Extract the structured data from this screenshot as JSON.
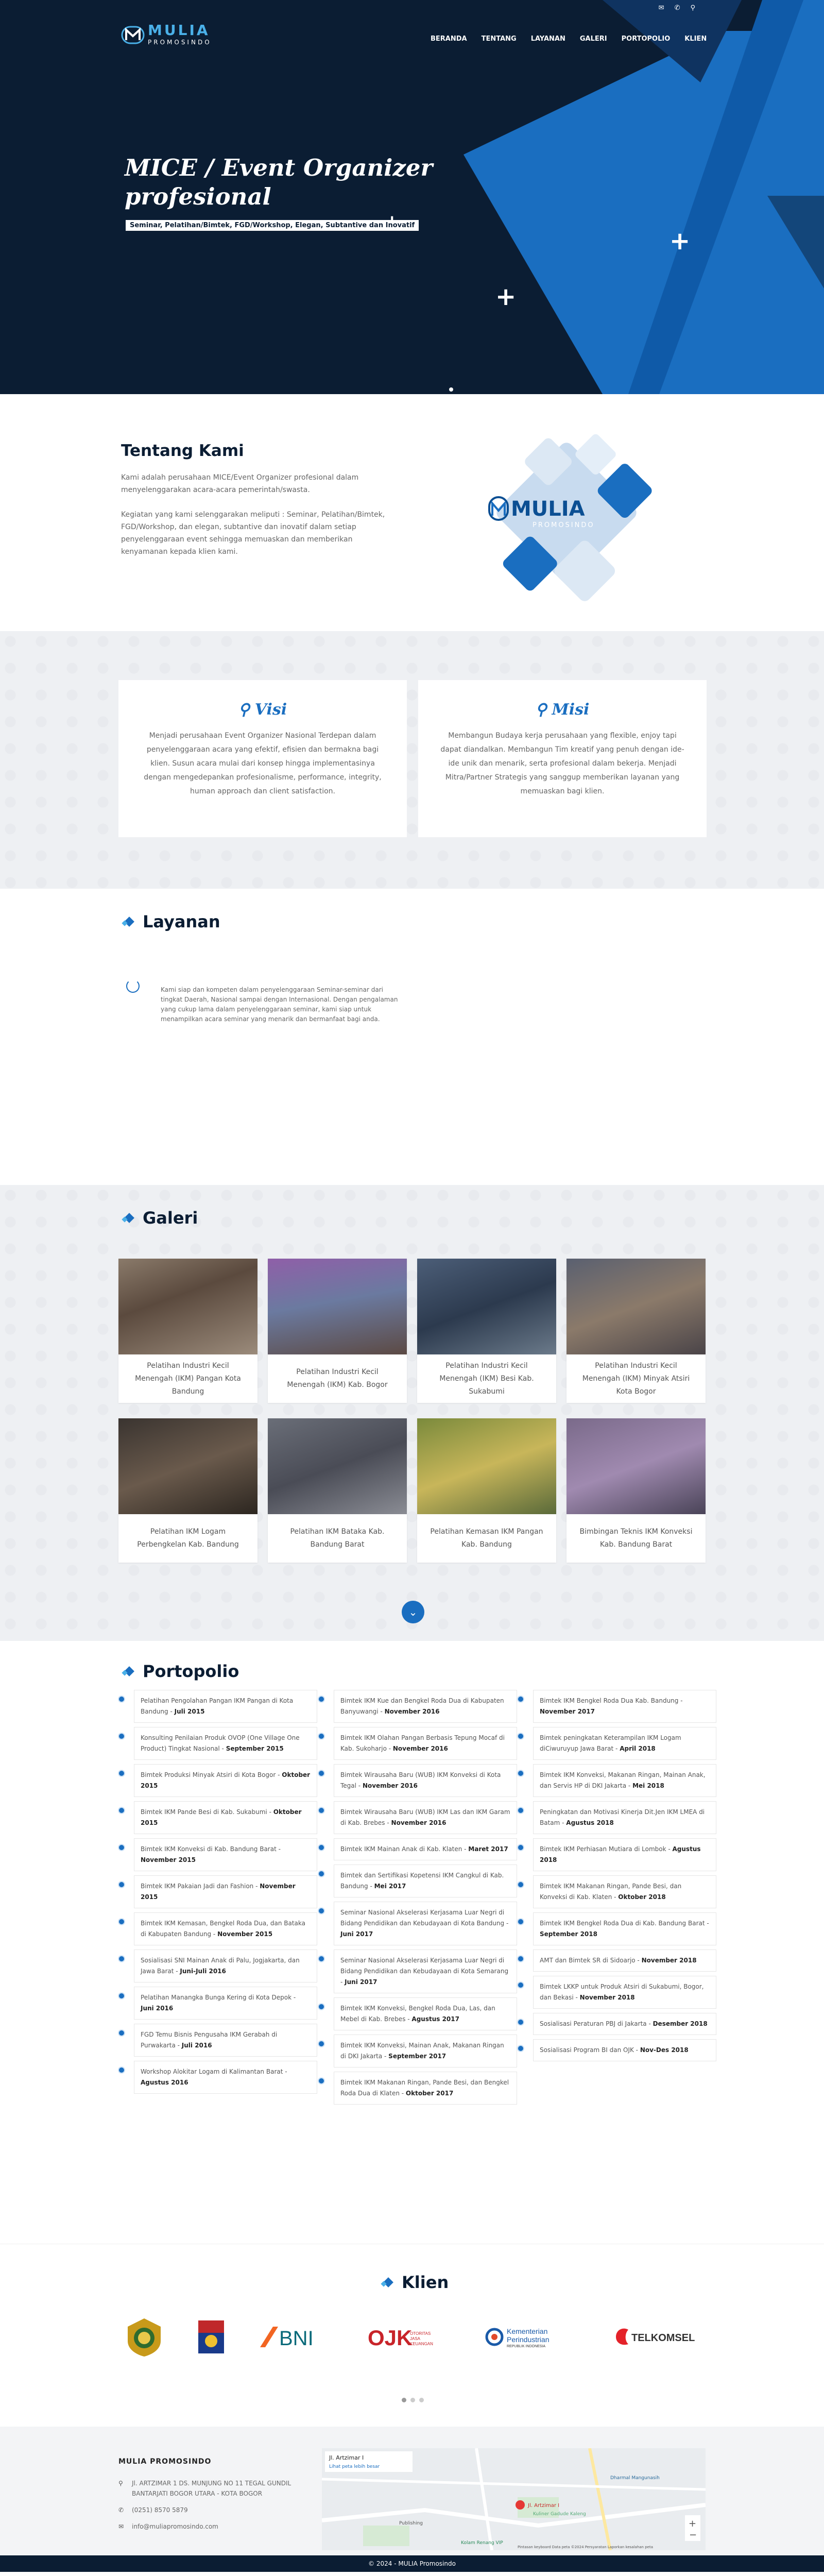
{
  "header": {
    "brand_name": "MULIA",
    "brand_sub": "PROMOSINDO",
    "top_icons": [
      "mail-icon",
      "phone-icon",
      "location-pin-icon"
    ],
    "nav": [
      "BERANDA",
      "TENTANG",
      "LAYANAN",
      "GALERI",
      "PORTOPOLIO",
      "KLIEN"
    ]
  },
  "hero": {
    "title_line1": "MICE / Event Organizer",
    "title_line2": "profesional",
    "subtitle": "Seminar, Pelatihan/Bimtek, FGD/Workshop, Elegan, Subtantive dan Inovatif"
  },
  "about": {
    "title": "Tentang Kami",
    "p1": "Kami adalah perusahaan MICE/Event Organizer profesional dalam menyelenggarakan acara-acara pemerintah/swasta.",
    "p2": "Kegiatan yang kami selenggarakan meliputi : Seminar, Pelatihan/Bimtek, FGD/Workshop, dan elegan, subtantive dan inovatif dalam setiap penyelenggaraan event sehingga memuaskan dan memberikan kenyamanan kepada klien kami.",
    "logo_name": "MULIA",
    "logo_sub": "PROMOSINDO"
  },
  "visi": {
    "title": "Visi",
    "text": "Menjadi perusahaan Event Organizer Nasional Terdepan dalam penyelenggaraan acara yang efektif, efisien dan bermakna bagi klien. Susun acara mulai dari konsep hingga implementasinya dengan mengedepankan profesionalisme, performance, integrity, human approach dan client satisfaction."
  },
  "misi": {
    "title": "Misi",
    "text": "Membangun Budaya kerja perusahaan yang flexible, enjoy tapi dapat diandalkan. Membangun Tim kreatif yang penuh dengan ide-ide unik dan menarik, serta profesional dalam bekerja. Menjadi Mitra/Partner Strategis yang sanggup memberikan layanan yang memuaskan bagi klien."
  },
  "layanan": {
    "title": "Layanan",
    "text": "Kami siap dan kompeten dalam penyelenggaraan Seminar-seminar dari tingkat Daerah, Nasional sampai dengan Internasional. Dengan pengalaman yang cukup lama dalam penyelenggaraan seminar, kami siap untuk menampilkan acara seminar yang menarik dan bermanfaat bagi anda."
  },
  "galeri": {
    "title": "Galeri",
    "items": [
      "Pelatihan Industri Kecil Menengah (IKM) Pangan Kota Bandung",
      "Pelatihan Industri Kecil Menengah (IKM) Kab. Bogor",
      "Pelatihan Industri Kecil Menengah (IKM) Besi Kab. Sukabumi",
      "Pelatihan Industri Kecil Menengah (IKM) Minyak Atsiri Kota Bogor",
      "Pelatihan IKM Logam Perbengkelan Kab. Bandung",
      "Pelatihan IKM Bataka Kab. Bandung Barat",
      "Pelatihan Kemasan IKM Pangan Kab. Bandung",
      "Bimbingan Teknis IKM Konveksi Kab. Bandung Barat"
    ],
    "more_icon": "chevron-down-icon"
  },
  "portopolio": {
    "title": "Portopolio",
    "col1": [
      {
        "t": "Pelatihan Pengolahan Pangan IKM Pangan di Kota Bandung - ",
        "d": "Juli 2015"
      },
      {
        "t": "Konsulting Penilaian Produk OVOP (One Village One Product) Tingkat Nasional - ",
        "d": "September 2015"
      },
      {
        "t": "Bimtek Produksi Minyak Atsiri di Kota Bogor - ",
        "d": "Oktober 2015"
      },
      {
        "t": "Bimtek IKM Pande Besi di Kab. Sukabumi - ",
        "d": "Oktober 2015"
      },
      {
        "t": "Bimtek IKM Konveksi di Kab. Bandung Barat - ",
        "d": "November 2015"
      },
      {
        "t": "Bimtek IKM Pakaian Jadi dan Fashion - ",
        "d": "November 2015"
      },
      {
        "t": "Bimtek IKM Kemasan, Bengkel Roda Dua, dan Bataka di Kabupaten Bandung - ",
        "d": "November 2015"
      },
      {
        "t": "Sosialisasi SNI Mainan Anak di Palu, Jogjakarta, dan Jawa Barat - ",
        "d": "Juni-Juli 2016"
      },
      {
        "t": "Pelatihan Manangka Bunga Kering di Kota Depok - ",
        "d": "Juni 2016"
      },
      {
        "t": "FGD Temu Bisnis Pengusaha IKM Gerabah di Purwakarta - ",
        "d": "Juli 2016"
      },
      {
        "t": "Workshop Alokitar Logam di Kalimantan Barat - ",
        "d": "Agustus 2016"
      }
    ],
    "col2": [
      {
        "t": "Bimtek IKM Kue dan Bengkel Roda Dua di Kabupaten Banyuwangi - ",
        "d": "November 2016"
      },
      {
        "t": "Bimtek IKM Olahan Pangan Berbasis Tepung Mocaf di Kab. Sukoharjo - ",
        "d": "November 2016"
      },
      {
        "t": "Bimtek Wirausaha Baru (WUB) IKM Konveksi di Kota Tegal - ",
        "d": "November 2016"
      },
      {
        "t": "Bimtek Wirausaha Baru (WUB) IKM Las dan IKM Garam di Kab. Brebes - ",
        "d": "November 2016"
      },
      {
        "t": "Bimtek IKM Mainan Anak di Kab. Klaten - ",
        "d": "Maret 2017"
      },
      {
        "t": "Bimtek dan Sertifikasi Kopetensi IKM Cangkul di Kab. Bandung - ",
        "d": "Mei 2017"
      },
      {
        "t": "Seminar Nasional Akselerasi Kerjasama Luar Negri di Bidang Pendidikan dan Kebudayaan di Kota Bandung - ",
        "d": "Juni 2017"
      },
      {
        "t": "Seminar Nasional Akselerasi Kerjasama Luar Negri di Bidang Pendidikan dan Kebudayaan di Kota Semarang - ",
        "d": "Juni 2017"
      },
      {
        "t": "Bimtek IKM Konveksi, Bengkel Roda Dua, Las, dan Mebel di Kab. Brebes - ",
        "d": "Agustus 2017"
      },
      {
        "t": "Bimtek IKM Konveksi, Mainan Anak, Makanan Ringan di DKI Jakarta - ",
        "d": "September 2017"
      },
      {
        "t": "Bimtek IKM Makanan Ringan, Pande Besi, dan Bengkel Roda Dua di Klaten - ",
        "d": "Oktober 2017"
      }
    ],
    "col3": [
      {
        "t": "Bimtek IKM Bengkel Roda Dua Kab. Bandung - ",
        "d": "November 2017"
      },
      {
        "t": "Bimtek peningkatan Keterampilan IKM Logam diCiwuruyup Jawa Barat - ",
        "d": "April 2018"
      },
      {
        "t": "Bimtek IKM Konveksi, Makanan Ringan, Mainan Anak, dan Servis HP di DKI Jakarta - ",
        "d": "Mei 2018"
      },
      {
        "t": "Peningkatan dan Motivasi Kinerja Dit.Jen IKM LMEA di Batam - ",
        "d": "Agustus 2018"
      },
      {
        "t": "Bimtek IKM Perhiasan Mutiara di Lombok - ",
        "d": "Agustus 2018"
      },
      {
        "t": "Bimtek IKM Makanan Ringan, Pande Besi, dan Konveksi di Kab. Klaten - ",
        "d": "Oktober 2018"
      },
      {
        "t": "Bimtek IKM Bengkel Roda Dua di Kab. Bandung Barat - ",
        "d": "September 2018"
      },
      {
        "t": "AMT dan Bimtek SR di Sidoarjo - ",
        "d": "November 2018"
      },
      {
        "t": "Bimtek LKKP untuk Produk Atsiri di Sukabumi, Bogor, dan Bekasi - ",
        "d": "November 2018"
      },
      {
        "t": "Sosialisasi Peraturan PBJ di Jakarta - ",
        "d": "Desember 2018"
      },
      {
        "t": "Sosialisasi Program BI dan OJK - ",
        "d": "Nov-Des 2018"
      }
    ]
  },
  "klien": {
    "title": "Klien",
    "logos": {
      "bni": "BNI",
      "ojk": "OJK",
      "ojk_sub": "OTORITAS JASA KEUANGAN",
      "kemenperin": "Kementerian Perindustrian",
      "kemenperin_sub": "REPUBLIK INDONESIA",
      "telkomsel": "TELKOMSEL"
    }
  },
  "footer": {
    "company": "MULIA PROMOSINDO",
    "address": "Jl. ARTZIMAR 1 DS. MUNJUNG NO 11 TEGAL GUNDIL BANTARJATI BOGOR UTARA - KOTA BOGOR",
    "phone": "(0251) 8570 5879",
    "email": "info@muliapromosindo.com",
    "map_title": "Jl. Artzimar I",
    "map_link": "Lihat peta lebih besar",
    "map_marker": "Jl. Artzimar I",
    "map_poi1": "Kuliner Gadude Kaleng",
    "map_poi2": "Publishing",
    "map_poi3": "Kolam Renang VIP",
    "map_poi4": "Dharmal Mangunasih",
    "map_foot": "Pintasan keyboard   Data peta ©2024   Persyaratan   Laporkan kesalahan peta",
    "copyright": "© 2024 - MULIA Promosindo"
  },
  "colors": {
    "navy": "#0b1d33",
    "blue": "#1a6ec0",
    "accent": "#4ab0e8"
  }
}
